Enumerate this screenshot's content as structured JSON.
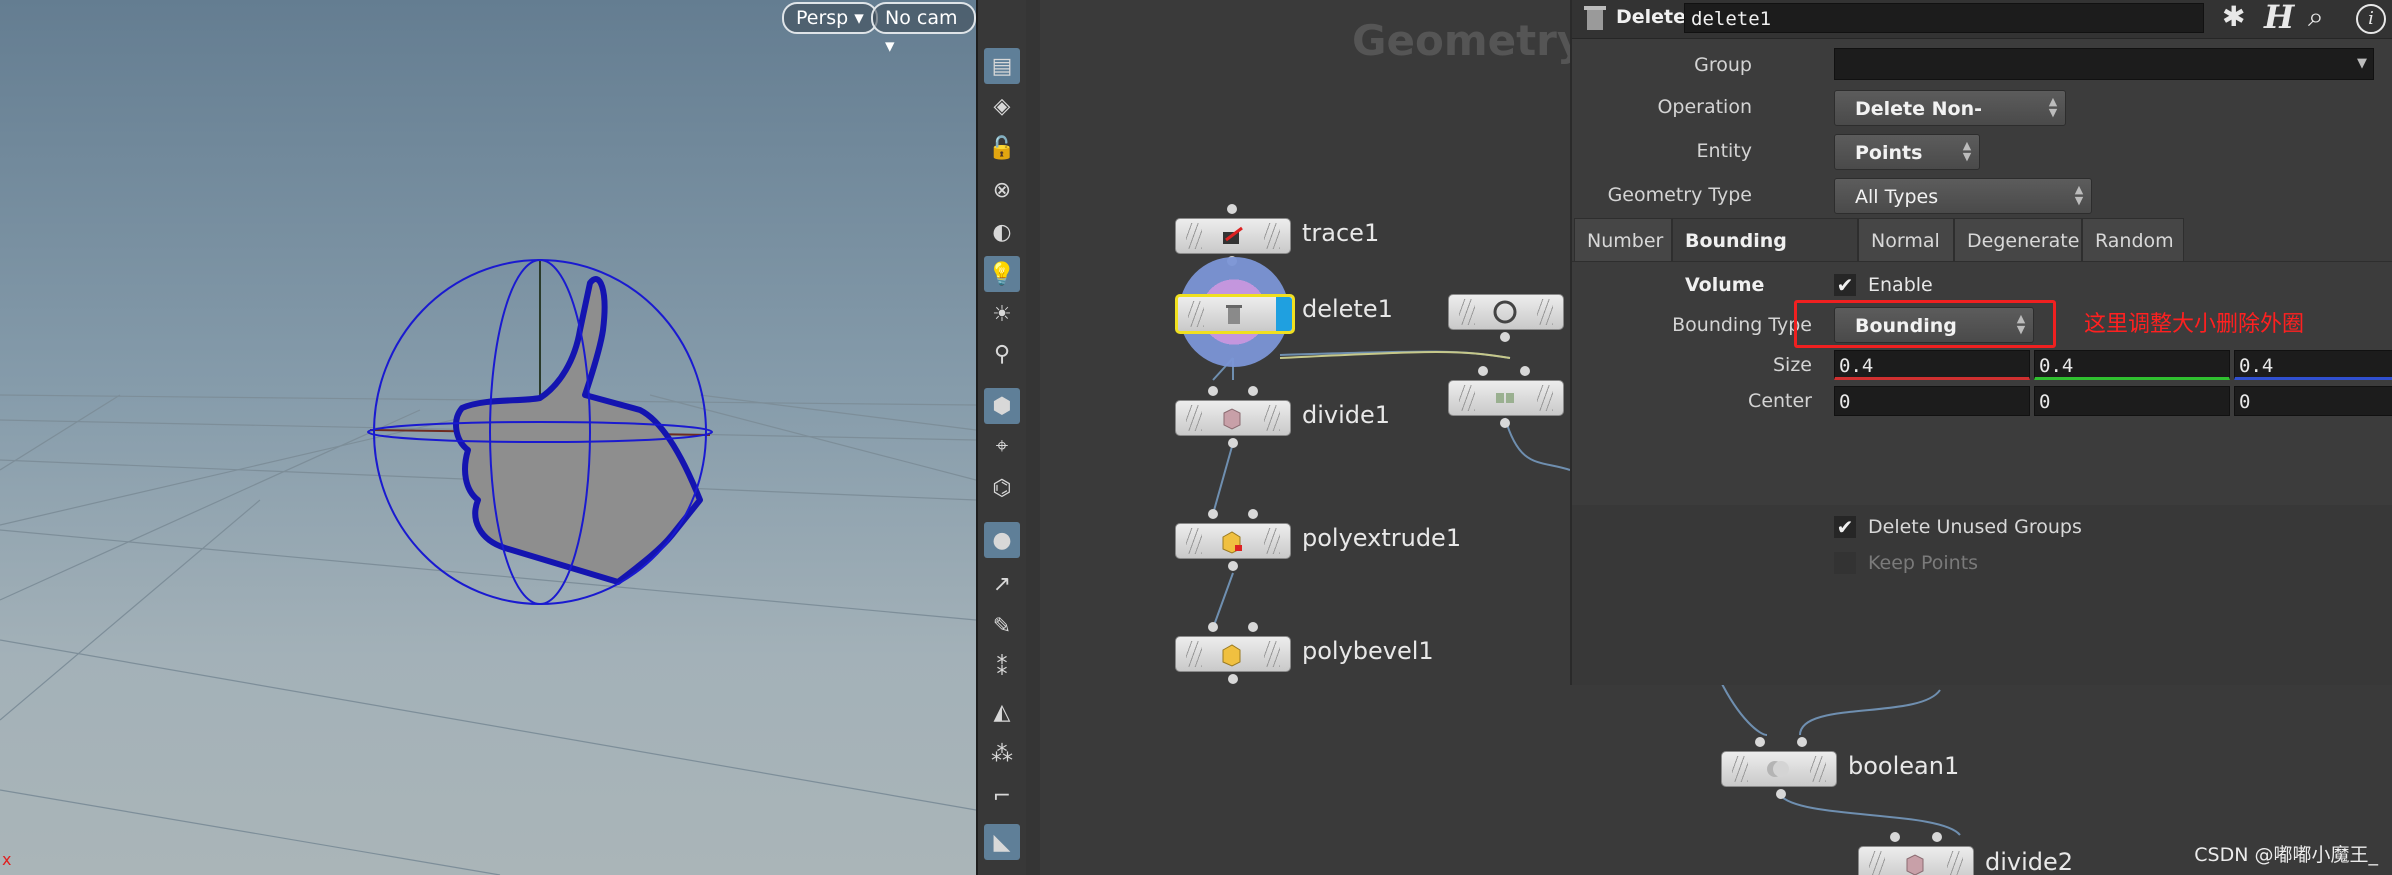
{
  "viewport": {
    "persp_label": "Persp",
    "cam_label": "No cam",
    "axis_label": "x"
  },
  "network": {
    "title": "Geometry",
    "nodes": [
      {
        "name": "trace1"
      },
      {
        "name": "delete1"
      },
      {
        "name": "divide1"
      },
      {
        "name": "polyextrude1"
      },
      {
        "name": "polybevel1"
      },
      {
        "name": "boolean1"
      },
      {
        "name": "divide2"
      }
    ]
  },
  "params": {
    "node_type": "Delete",
    "node_name": "delete1",
    "group_label": "Group",
    "group_value": "",
    "operation_label": "Operation",
    "operation_value": "Delete Non-Selected",
    "entity_label": "Entity",
    "entity_value": "Points",
    "geometry_type_label": "Geometry Type",
    "geometry_type_value": "All Types",
    "tabs": [
      "Number",
      "Bounding Volume",
      "Normal",
      "Degenerate",
      "Random"
    ],
    "active_tab": "Bounding Volume",
    "enable_label": "Enable",
    "enable_checked": true,
    "bounding_type_label": "Bounding Type",
    "bounding_type_value": "Bounding Sphere",
    "size_label": "Size",
    "size_values": [
      "0.4",
      "0.4",
      "0.4"
    ],
    "center_label": "Center",
    "center_values": [
      "0",
      "0",
      "0"
    ],
    "delete_unused_groups_label": "Delete Unused Groups",
    "delete_unused_groups_checked": true,
    "keep_points_label": "Keep Points",
    "keep_points_checked": false
  },
  "annotation": {
    "text": "这里调整大小删除外圈",
    "color": "#ff2020"
  },
  "watermark": "CSDN @嘟嘟小魔王_",
  "colors": {
    "accent_selected": "#f0e020",
    "display_flag": "#1fa0e0",
    "x_axis": "#d03030",
    "y_axis": "#30c030",
    "z_axis": "#3050d0",
    "bound_sphere": "#1a1ad0"
  },
  "shelf_tools": [
    "view-icon",
    "select-icon",
    "lock-icon",
    "xray-icon",
    "ghost-icon",
    "light-icon",
    "bulb-icon",
    "camera-light-icon",
    "display-icon",
    "snap-icon",
    "handle-icon",
    "point-icon",
    "brush-icon",
    "paint-icon",
    "number-icon",
    "eraser-icon",
    "number-icon-2",
    "pen-icon",
    "edge-icon",
    "shade-icon"
  ]
}
